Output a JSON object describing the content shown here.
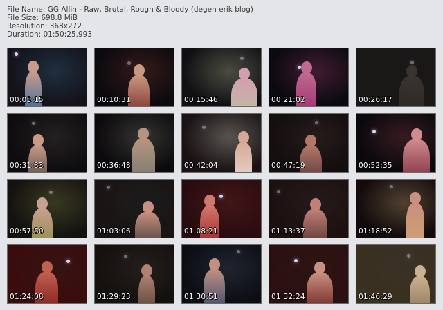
{
  "info": {
    "file_name": "File Name: GG Allin - Raw, Brutal, Rough & Bloody (degen erik blog)",
    "file_size": "File Size: 698.8 MiB",
    "resolution": "Resolution: 368x272",
    "duration": "Duration: 01:50:25.993"
  },
  "thumbnails": [
    {
      "time": "00:05:15",
      "bg": "#14121a",
      "skin": "#c89c8c",
      "accent": "#3a6a9a"
    },
    {
      "time": "00:10:31",
      "bg": "#0c0a0e",
      "skin": "#c89880",
      "accent": "#7a2a2a"
    },
    {
      "time": "00:15:46",
      "bg": "#101014",
      "skin": "#d0a0b0",
      "accent": "#c0c0a0"
    },
    {
      "time": "00:21:02",
      "bg": "#0a0a10",
      "skin": "#c06a90",
      "accent": "#a03070"
    },
    {
      "time": "00:26:17",
      "bg": "#1a1816",
      "skin": "#3a3430",
      "accent": "#2a2622"
    },
    {
      "time": "00:31:33",
      "bg": "#0e0c0e",
      "skin": "#c89a88",
      "accent": "#4a4040"
    },
    {
      "time": "00:36:48",
      "bg": "#0c0a0c",
      "skin": "#b89480",
      "accent": "#7a7a70"
    },
    {
      "time": "00:42:04",
      "bg": "#1a1214",
      "skin": "#d8a898",
      "accent": "#e8d8d0"
    },
    {
      "time": "00:47:19",
      "bg": "#140e0e",
      "skin": "#b07868",
      "accent": "#503030"
    },
    {
      "time": "00:52:35",
      "bg": "#0a080c",
      "skin": "#d08a90",
      "accent": "#803040"
    },
    {
      "time": "00:57:50",
      "bg": "#141210",
      "skin": "#c8a090",
      "accent": "#8a8a40"
    },
    {
      "time": "01:03:06",
      "bg": "#1a1414",
      "skin": "#c89080",
      "accent": "#303030"
    },
    {
      "time": "01:08:21",
      "bg": "#2a0c10",
      "skin": "#d07870",
      "accent": "#a02020"
    },
    {
      "time": "01:13:37",
      "bg": "#1c1010",
      "skin": "#c08078",
      "accent": "#502a2a"
    },
    {
      "time": "01:18:52",
      "bg": "#120a0c",
      "skin": "#c89080",
      "accent": "#d0a070"
    },
    {
      "time": "01:24:08",
      "bg": "#3a0c0c",
      "skin": "#c06050",
      "accent": "#801818"
    },
    {
      "time": "01:29:23",
      "bg": "#14100e",
      "skin": "#b08070",
      "accent": "#4a3a30"
    },
    {
      "time": "01:30:51",
      "bg": "#0c0e14",
      "skin": "#c09080",
      "accent": "#3a4a6a"
    },
    {
      "time": "01:32:24",
      "bg": "#2a1010",
      "skin": "#c89080",
      "accent": "#6a1a1a"
    },
    {
      "time": "01:46:29",
      "bg": "#3a3020",
      "skin": "#c8b090",
      "accent": "#8a7050"
    }
  ]
}
